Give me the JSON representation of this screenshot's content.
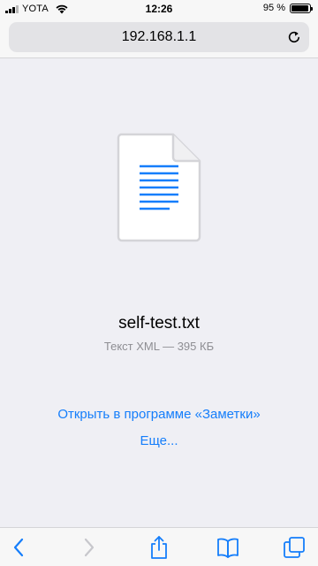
{
  "status_bar": {
    "carrier": "YOTA",
    "time": "12:26",
    "battery_percent": "95 %",
    "battery_level": 0.95
  },
  "browser": {
    "url": "192.168.1.1"
  },
  "file": {
    "name": "self-test.txt",
    "info": "Текст XML — 395 КБ"
  },
  "actions": {
    "open_in_notes": "Открыть в программе «Заметки»",
    "more": "Еще..."
  },
  "colors": {
    "accent": "#157efb",
    "background": "#efeff4",
    "secondary_text": "#8e8e93"
  },
  "toolbar": {
    "icons": [
      "back-icon",
      "forward-icon",
      "share-icon",
      "bookmarks-icon",
      "tabs-icon"
    ]
  }
}
